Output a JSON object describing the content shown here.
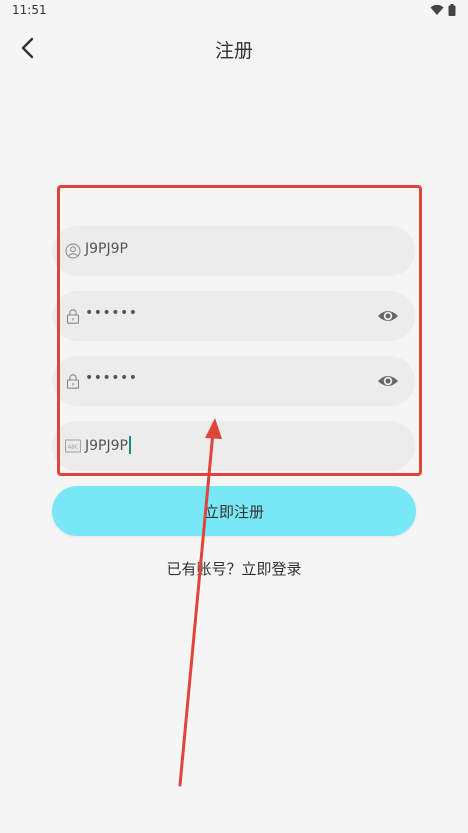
{
  "status_bar": {
    "time": "11:51",
    "icons": [
      "wifi-icon",
      "battery-icon"
    ]
  },
  "header": {
    "title": "注册",
    "back_icon": "chevron-left-icon"
  },
  "form": {
    "username": {
      "value": "J9PJ9P",
      "icon": "user-circle-icon"
    },
    "password": {
      "value": "••••••",
      "icon": "lock-icon",
      "toggle_icon": "eye-icon"
    },
    "confirm_password": {
      "value": "••••••",
      "icon": "lock-icon",
      "toggle_icon": "eye-icon"
    },
    "captcha": {
      "value": "J9PJ9P",
      "icon": "abc-icon"
    }
  },
  "register_button": {
    "label": "立即注册"
  },
  "login_prompt": {
    "label": "已有账号？立即登录"
  },
  "colors": {
    "accent": "#79e8f6",
    "annotation": "#e0443a",
    "field_bg": "#ececec",
    "page_bg": "#f5f5f5"
  }
}
